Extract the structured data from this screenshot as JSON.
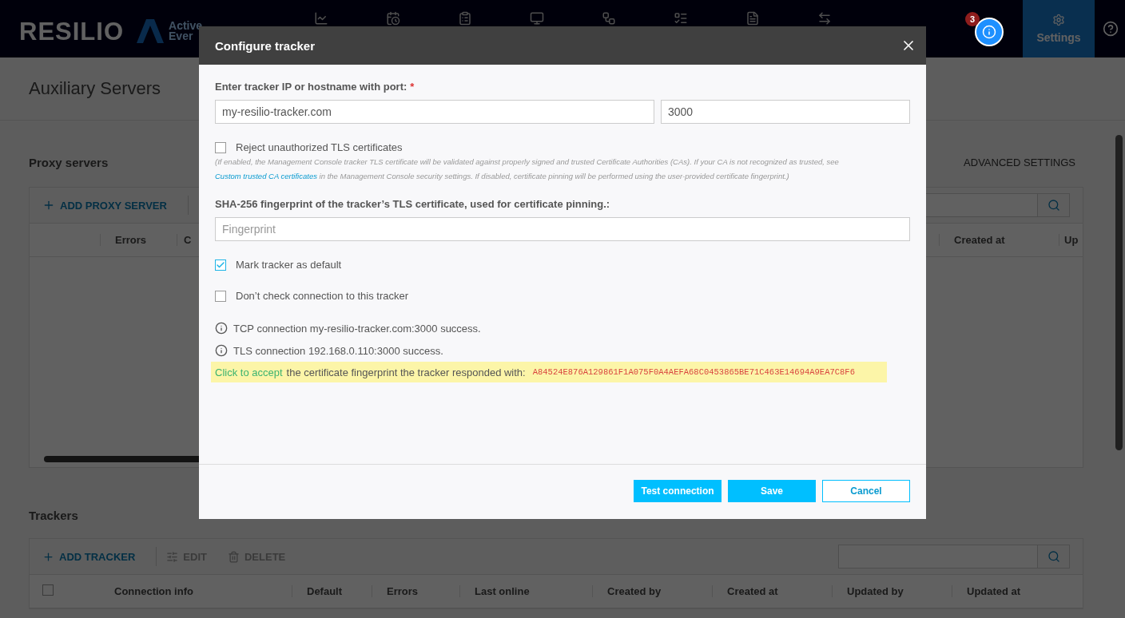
{
  "header": {
    "logo": "RESILIO",
    "partner_logo": [
      "Active",
      "Ever"
    ],
    "notification_count": "3",
    "settings_tab": {
      "label": "Settings",
      "selected": true
    }
  },
  "page": {
    "title": "Auxiliary Servers"
  },
  "proxy_servers": {
    "title": "Proxy servers",
    "advanced_settings": "ADVANCED SETTINGS",
    "add_button": "ADD PROXY SERVER",
    "columns_left": [
      "Errors",
      "C"
    ],
    "columns_right": [
      "Created at",
      "Up"
    ]
  },
  "trackers": {
    "title": "Trackers",
    "toolbar": [
      {
        "label": "ADD TRACKER",
        "kind": "add",
        "disabled": false
      },
      {
        "label": "EDIT",
        "kind": "edit",
        "disabled": true
      },
      {
        "label": "DELETE",
        "kind": "delete",
        "disabled": true
      }
    ],
    "select_all": {
      "checked": false
    },
    "columns": [
      "Connection info",
      "Default",
      "Errors",
      "Last online",
      "Created by",
      "Created at",
      "Updated by",
      "Updated at"
    ]
  },
  "dialog": {
    "title": "Configure tracker",
    "host_label": "Enter tracker IP or hostname with port:",
    "required_mark": "*",
    "host_value": "my-resilio-tracker.com",
    "port_value": "3000",
    "reject_option": {
      "label": "Reject unauthorized TLS certificates",
      "checked": false,
      "note_before": "(If enabled, the Management Console tracker TLS certificate will be validated against properly signed and trusted Certificate Authorities (CAs).  If your CA is not recognized as trusted, see",
      "note_link": "Custom trusted CA certificates",
      "note_after": "in the Management Console security settings.  If disabled, certificate pinning will be performed using the user-provided certificate fingerprint.)"
    },
    "fingerprint_label": "SHA-256 fingerprint of the tracker’s TLS certificate, used for certificate pinning.:",
    "fingerprint_placeholder": "Fingerprint",
    "options": [
      {
        "label": "Mark tracker as default",
        "checked": true
      },
      {
        "label": "Don’t check connection to this tracker",
        "checked": false
      }
    ],
    "messages": [
      "TCP connection my-resilio-tracker.com:3000 success.",
      "TLS connection 192.168.0.110:3000 success."
    ],
    "accept": {
      "link": "Click to accept",
      "text": "the certificate fingerprint the tracker responded with:",
      "fingerprint": "A84524E876A129861F1A075F0A4AEFA68C0453865BE71C463E14694A9EA7C8F6"
    },
    "buttons": [
      {
        "label": "Test connection",
        "kind": "primary"
      },
      {
        "label": "Save",
        "kind": "primary"
      },
      {
        "label": "Cancel",
        "kind": "secondary"
      }
    ]
  }
}
